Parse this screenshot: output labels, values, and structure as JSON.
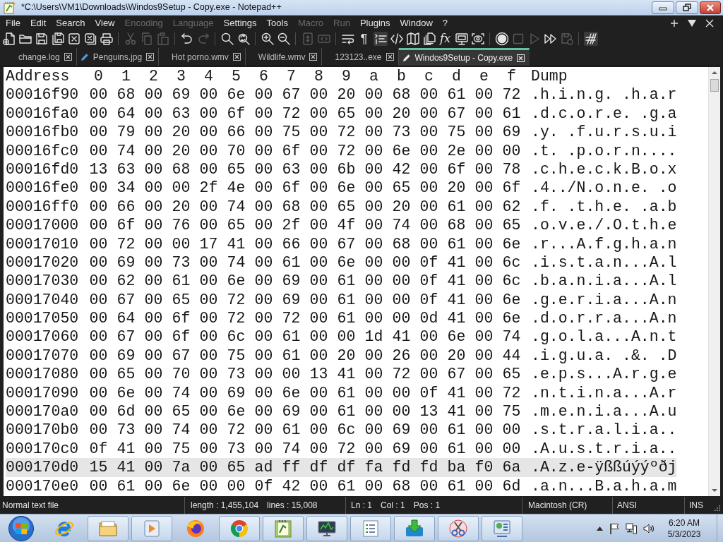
{
  "window": {
    "title": "*C:\\Users\\VM1\\Downloads\\Windos9Setup - Copy.exe - Notepad++"
  },
  "menu": [
    {
      "label": "File",
      "disabled": false
    },
    {
      "label": "Edit",
      "disabled": false
    },
    {
      "label": "Search",
      "disabled": false
    },
    {
      "label": "View",
      "disabled": false
    },
    {
      "label": "Encoding",
      "disabled": true
    },
    {
      "label": "Language",
      "disabled": true
    },
    {
      "label": "Settings",
      "disabled": false
    },
    {
      "label": "Tools",
      "disabled": false
    },
    {
      "label": "Macro",
      "disabled": true
    },
    {
      "label": "Run",
      "disabled": true
    },
    {
      "label": "Plugins",
      "disabled": false
    },
    {
      "label": "Window",
      "disabled": false
    },
    {
      "label": "?",
      "disabled": false
    }
  ],
  "toolbar": [
    {
      "kind": "new",
      "disabled": false,
      "pressed": false
    },
    {
      "kind": "open",
      "disabled": false,
      "pressed": false
    },
    {
      "kind": "save",
      "disabled": false,
      "pressed": false
    },
    {
      "kind": "save-all",
      "disabled": false,
      "pressed": false
    },
    {
      "kind": "close",
      "disabled": false,
      "pressed": false
    },
    {
      "kind": "close-all",
      "disabled": false,
      "pressed": false
    },
    {
      "kind": "print",
      "disabled": false,
      "pressed": false
    },
    {
      "kind": "separator"
    },
    {
      "kind": "cut",
      "disabled": true,
      "pressed": false
    },
    {
      "kind": "copy",
      "disabled": true,
      "pressed": false
    },
    {
      "kind": "paste",
      "disabled": true,
      "pressed": false
    },
    {
      "kind": "separator"
    },
    {
      "kind": "undo",
      "disabled": false,
      "pressed": false
    },
    {
      "kind": "redo",
      "disabled": true,
      "pressed": false
    },
    {
      "kind": "separator"
    },
    {
      "kind": "find",
      "disabled": false,
      "pressed": false
    },
    {
      "kind": "replace",
      "disabled": false,
      "pressed": false
    },
    {
      "kind": "separator"
    },
    {
      "kind": "zoom-in",
      "disabled": false,
      "pressed": false
    },
    {
      "kind": "zoom-out",
      "disabled": false,
      "pressed": false
    },
    {
      "kind": "separator"
    },
    {
      "kind": "sync-vertical",
      "disabled": true,
      "pressed": false
    },
    {
      "kind": "sync-horizontal",
      "disabled": true,
      "pressed": false
    },
    {
      "kind": "separator"
    },
    {
      "kind": "word-wrap",
      "disabled": false,
      "pressed": false
    },
    {
      "kind": "show-all-characters",
      "glyph": "¶",
      "disabled": false,
      "pressed": false
    },
    {
      "kind": "indent-guide",
      "disabled": false,
      "pressed": true
    },
    {
      "kind": "xml-tags",
      "disabled": false,
      "pressed": false
    },
    {
      "kind": "document-map",
      "disabled": false,
      "pressed": false
    },
    {
      "kind": "document-list",
      "disabled": false,
      "pressed": false
    },
    {
      "kind": "function-list",
      "glyph": "fx",
      "disabled": false,
      "pressed": false
    },
    {
      "kind": "folder-workspace",
      "disabled": false,
      "pressed": false
    },
    {
      "kind": "monitoring",
      "disabled": false,
      "pressed": false
    },
    {
      "kind": "separator"
    },
    {
      "kind": "record",
      "disabled": false,
      "pressed": false
    },
    {
      "kind": "stop",
      "disabled": true,
      "pressed": false
    },
    {
      "kind": "play",
      "disabled": true,
      "pressed": false
    },
    {
      "kind": "play-multiple",
      "disabled": false,
      "pressed": false
    },
    {
      "kind": "save-macro",
      "disabled": true,
      "pressed": false
    },
    {
      "kind": "separator"
    },
    {
      "kind": "hatch",
      "disabled": false,
      "pressed": true
    }
  ],
  "tabs": [
    {
      "label": "change.log",
      "selected": false,
      "modified": false
    },
    {
      "label": "Penguins.jpg",
      "selected": false,
      "modified": true
    },
    {
      "label": "Hot porno.wmv",
      "selected": false,
      "modified": false
    },
    {
      "label": "Wildlife.wmv",
      "selected": false,
      "modified": false
    },
    {
      "label": "123123..exe",
      "selected": false,
      "modified": false
    },
    {
      "label": "Windos9Setup - Copy.exe",
      "selected": true,
      "modified": true
    }
  ],
  "hex_view": {
    "columns": [
      "Address",
      "0",
      "1",
      "2",
      "3",
      "4",
      "5",
      "6",
      "7",
      "8",
      "9",
      "a",
      "b",
      "c",
      "d",
      "e",
      "f",
      "Dump"
    ],
    "rows": [
      {
        "address": "00016f90",
        "bytes": [
          "00",
          "68",
          "00",
          "69",
          "00",
          "6e",
          "00",
          "67",
          "00",
          "20",
          "00",
          "68",
          "00",
          "61",
          "00",
          "72"
        ],
        "dump": ".h.i.n.g. .h.a.r",
        "current": false
      },
      {
        "address": "00016fa0",
        "bytes": [
          "00",
          "64",
          "00",
          "63",
          "00",
          "6f",
          "00",
          "72",
          "00",
          "65",
          "00",
          "20",
          "00",
          "67",
          "00",
          "61"
        ],
        "dump": ".d.c.o.r.e. .g.a",
        "current": false
      },
      {
        "address": "00016fb0",
        "bytes": [
          "00",
          "79",
          "00",
          "20",
          "00",
          "66",
          "00",
          "75",
          "00",
          "72",
          "00",
          "73",
          "00",
          "75",
          "00",
          "69"
        ],
        "dump": ".y. .f.u.r.s.u.i",
        "current": false
      },
      {
        "address": "00016fc0",
        "bytes": [
          "00",
          "74",
          "00",
          "20",
          "00",
          "70",
          "00",
          "6f",
          "00",
          "72",
          "00",
          "6e",
          "00",
          "2e",
          "00",
          "00"
        ],
        "dump": ".t. .p.o.r.n....",
        "current": false
      },
      {
        "address": "00016fd0",
        "bytes": [
          "13",
          "63",
          "00",
          "68",
          "00",
          "65",
          "00",
          "63",
          "00",
          "6b",
          "00",
          "42",
          "00",
          "6f",
          "00",
          "78"
        ],
        "dump": ".c.h.e.c.k.B.o.x",
        "current": false
      },
      {
        "address": "00016fe0",
        "bytes": [
          "00",
          "34",
          "00",
          "00",
          "2f",
          "4e",
          "00",
          "6f",
          "00",
          "6e",
          "00",
          "65",
          "00",
          "20",
          "00",
          "6f"
        ],
        "dump": ".4../N.o.n.e. .o",
        "current": false
      },
      {
        "address": "00016ff0",
        "bytes": [
          "00",
          "66",
          "00",
          "20",
          "00",
          "74",
          "00",
          "68",
          "00",
          "65",
          "00",
          "20",
          "00",
          "61",
          "00",
          "62"
        ],
        "dump": ".f. .t.h.e. .a.b",
        "current": false
      },
      {
        "address": "00017000",
        "bytes": [
          "00",
          "6f",
          "00",
          "76",
          "00",
          "65",
          "00",
          "2f",
          "00",
          "4f",
          "00",
          "74",
          "00",
          "68",
          "00",
          "65"
        ],
        "dump": ".o.v.e./.O.t.h.e",
        "current": false
      },
      {
        "address": "00017010",
        "bytes": [
          "00",
          "72",
          "00",
          "00",
          "17",
          "41",
          "00",
          "66",
          "00",
          "67",
          "00",
          "68",
          "00",
          "61",
          "00",
          "6e"
        ],
        "dump": ".r...A.f.g.h.a.n",
        "current": false
      },
      {
        "address": "00017020",
        "bytes": [
          "00",
          "69",
          "00",
          "73",
          "00",
          "74",
          "00",
          "61",
          "00",
          "6e",
          "00",
          "00",
          "0f",
          "41",
          "00",
          "6c"
        ],
        "dump": ".i.s.t.a.n...A.l",
        "current": false
      },
      {
        "address": "00017030",
        "bytes": [
          "00",
          "62",
          "00",
          "61",
          "00",
          "6e",
          "00",
          "69",
          "00",
          "61",
          "00",
          "00",
          "0f",
          "41",
          "00",
          "6c"
        ],
        "dump": ".b.a.n.i.a...A.l",
        "current": false
      },
      {
        "address": "00017040",
        "bytes": [
          "00",
          "67",
          "00",
          "65",
          "00",
          "72",
          "00",
          "69",
          "00",
          "61",
          "00",
          "00",
          "0f",
          "41",
          "00",
          "6e"
        ],
        "dump": ".g.e.r.i.a...A.n",
        "current": false
      },
      {
        "address": "00017050",
        "bytes": [
          "00",
          "64",
          "00",
          "6f",
          "00",
          "72",
          "00",
          "72",
          "00",
          "61",
          "00",
          "00",
          "0d",
          "41",
          "00",
          "6e"
        ],
        "dump": ".d.o.r.r.a...A.n",
        "current": false
      },
      {
        "address": "00017060",
        "bytes": [
          "00",
          "67",
          "00",
          "6f",
          "00",
          "6c",
          "00",
          "61",
          "00",
          "00",
          "1d",
          "41",
          "00",
          "6e",
          "00",
          "74"
        ],
        "dump": ".g.o.l.a...A.n.t",
        "current": false
      },
      {
        "address": "00017070",
        "bytes": [
          "00",
          "69",
          "00",
          "67",
          "00",
          "75",
          "00",
          "61",
          "00",
          "20",
          "00",
          "26",
          "00",
          "20",
          "00",
          "44"
        ],
        "dump": ".i.g.u.a. .&. .D",
        "current": false
      },
      {
        "address": "00017080",
        "bytes": [
          "00",
          "65",
          "00",
          "70",
          "00",
          "73",
          "00",
          "00",
          "13",
          "41",
          "00",
          "72",
          "00",
          "67",
          "00",
          "65"
        ],
        "dump": ".e.p.s...A.r.g.e",
        "current": false
      },
      {
        "address": "00017090",
        "bytes": [
          "00",
          "6e",
          "00",
          "74",
          "00",
          "69",
          "00",
          "6e",
          "00",
          "61",
          "00",
          "00",
          "0f",
          "41",
          "00",
          "72"
        ],
        "dump": ".n.t.i.n.a...A.r",
        "current": false
      },
      {
        "address": "000170a0",
        "bytes": [
          "00",
          "6d",
          "00",
          "65",
          "00",
          "6e",
          "00",
          "69",
          "00",
          "61",
          "00",
          "00",
          "13",
          "41",
          "00",
          "75"
        ],
        "dump": ".m.e.n.i.a...A.u",
        "current": false
      },
      {
        "address": "000170b0",
        "bytes": [
          "00",
          "73",
          "00",
          "74",
          "00",
          "72",
          "00",
          "61",
          "00",
          "6c",
          "00",
          "69",
          "00",
          "61",
          "00",
          "00"
        ],
        "dump": ".s.t.r.a.l.i.a..",
        "current": false
      },
      {
        "address": "000170c0",
        "bytes": [
          "0f",
          "41",
          "00",
          "75",
          "00",
          "73",
          "00",
          "74",
          "00",
          "72",
          "00",
          "69",
          "00",
          "61",
          "00",
          "00"
        ],
        "dump": ".A.u.s.t.r.i.a..",
        "current": false
      },
      {
        "address": "000170d0",
        "bytes": [
          "15",
          "41",
          "00",
          "7a",
          "00",
          "65",
          "ad",
          "ff",
          "df",
          "df",
          "fa",
          "fd",
          "fd",
          "ba",
          "f0",
          "6a"
        ],
        "dump": ".A.z.e-ÿßßúýýºðj",
        "current": true
      },
      {
        "address": "000170e0",
        "bytes": [
          "00",
          "61",
          "00",
          "6e",
          "00",
          "00",
          "0f",
          "42",
          "00",
          "61",
          "00",
          "68",
          "00",
          "61",
          "00",
          "6d"
        ],
        "dump": ".a.n...B.a.h.a.m",
        "current": false
      }
    ]
  },
  "status_bar": [
    {
      "texts": [
        "Normal text file"
      ]
    },
    {
      "texts": [
        "length : 1,455,104",
        "lines : 15,008"
      ]
    },
    {
      "texts": [
        "Ln : 1",
        "Col : 1",
        "Pos : 1"
      ]
    },
    {
      "texts": [
        "Macintosh (CR)"
      ]
    },
    {
      "texts": [
        "ANSI"
      ]
    },
    {
      "texts": [
        "INS"
      ]
    }
  ],
  "taskbar": {
    "apps": [
      {
        "kind": "e-browser",
        "running": false
      },
      {
        "kind": "folder",
        "running": true
      },
      {
        "kind": "media",
        "running": true
      },
      {
        "kind": "fox-browser",
        "running": false
      },
      {
        "kind": "circle-browser",
        "running": true
      },
      {
        "kind": "notepad",
        "running": true
      },
      {
        "kind": "monitor",
        "running": true
      },
      {
        "kind": "checklist",
        "running": true
      },
      {
        "kind": "download",
        "running": true
      },
      {
        "kind": "scissors",
        "running": true
      },
      {
        "kind": "control-panel",
        "running": true
      }
    ],
    "clock": {
      "time": "6:20 AM",
      "date": "5/3/2023"
    }
  }
}
